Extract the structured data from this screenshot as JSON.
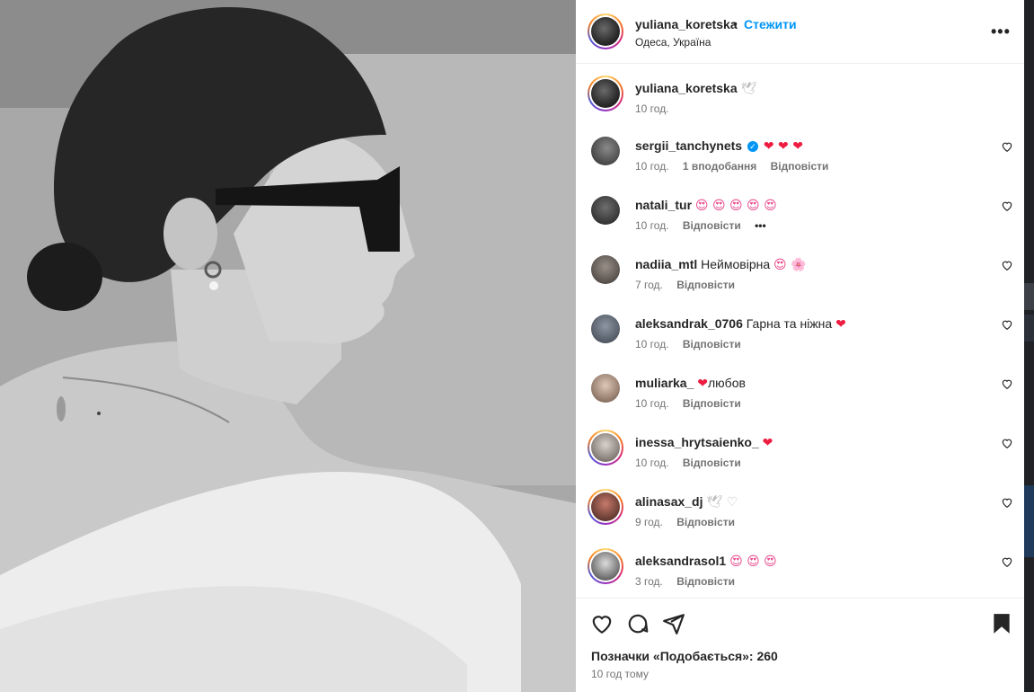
{
  "header": {
    "username": "yuliana_koretska",
    "dot": "•",
    "follow_label": "Стежити",
    "location": "Одеса, Україна",
    "more": "•••"
  },
  "caption": {
    "username": "yuliana_koretska",
    "emoji": "🕊",
    "time": "10 год."
  },
  "comments": [
    {
      "username": "sergii_tanchynets",
      "verified": true,
      "text": "❤ ❤ ❤",
      "time": "10 год.",
      "likes": "1 вподобання",
      "reply": "Відповісти"
    },
    {
      "username": "natali_tur",
      "text": "😍 😍 😍 😍 😍",
      "time": "10 год.",
      "reply": "Відповісти",
      "more": "•••"
    },
    {
      "username": "nadiia_mtl",
      "text": "Неймовірна",
      "emoji": "😍 🌸",
      "time": "7 год.",
      "reply": "Відповісти"
    },
    {
      "username": "aleksandrak_0706",
      "text": "Гарна та ніжна",
      "emoji": "❤",
      "time": "10 год.",
      "reply": "Відповісти"
    },
    {
      "username": "muliarka_",
      "emoji": "❤",
      "text": "любов",
      "time": "10 год.",
      "reply": "Відповісти"
    },
    {
      "username": "inessa_hrytsaienko_",
      "emoji": "❤",
      "time": "10 год.",
      "reply": "Відповісти"
    },
    {
      "username": "alinasax_dj",
      "emoji": "🕊 ♡",
      "time": "9 год.",
      "reply": "Відповісти"
    },
    {
      "username": "aleksandrasol1",
      "text": "😍 😍 😍",
      "time": "3 год.",
      "reply": "Відповісти"
    }
  ],
  "footer": {
    "likes_label": "Позначки «Подобається»: 260",
    "time_ago": "10 год тому"
  },
  "icons": {
    "like": "heart-icon",
    "comment": "comment-icon",
    "share": "send-icon",
    "save": "bookmark-icon"
  }
}
